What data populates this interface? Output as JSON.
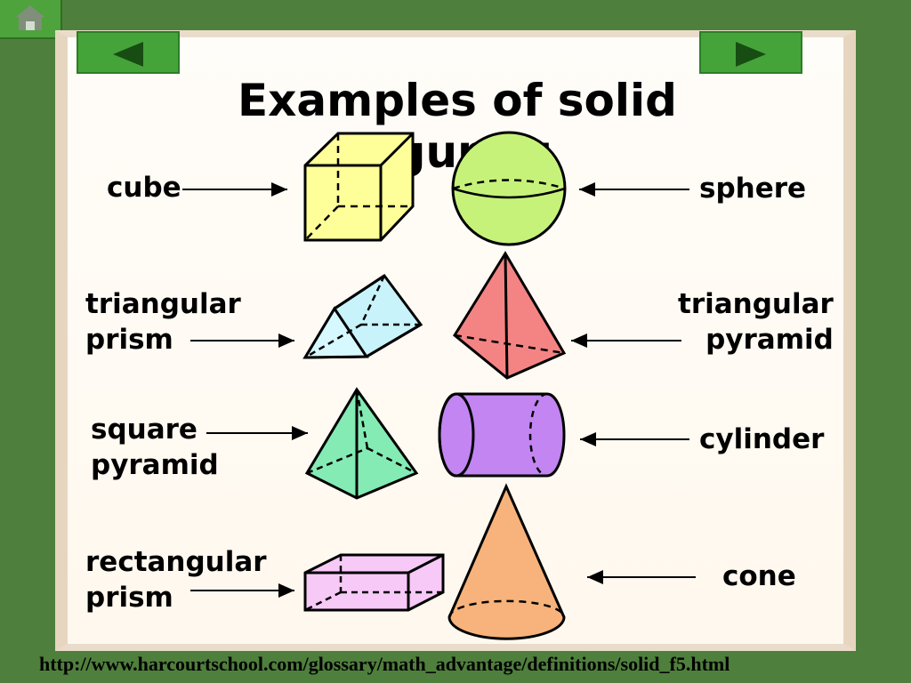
{
  "title": "Examples of solid figures:",
  "labels": {
    "cube": "cube",
    "triangular_prism": "triangular\nprism",
    "square_pyramid": "square\npyramid",
    "rectangular_prism": "rectangular\nprism",
    "sphere": "sphere",
    "triangular_pyramid": "triangular\npyramid",
    "cylinder": "cylinder",
    "cone": "cone"
  },
  "url": "http://www.harcourtschool.com/glossary/math_advantage/definitions/solid_f5.html",
  "colors": {
    "cube": "#ffff99",
    "sphere": "#c6f27a",
    "triangular_prism": "#c8f3fb",
    "triangular_pyramid": "#f48484",
    "square_pyramid": "#84ebb4",
    "cylinder": "#c285f2",
    "rectangular_prism": "#f7c9f7",
    "cone": "#f7b37b"
  },
  "icons": {
    "home": "home-icon",
    "previous": "left-arrow-icon",
    "next": "right-arrow-icon"
  }
}
